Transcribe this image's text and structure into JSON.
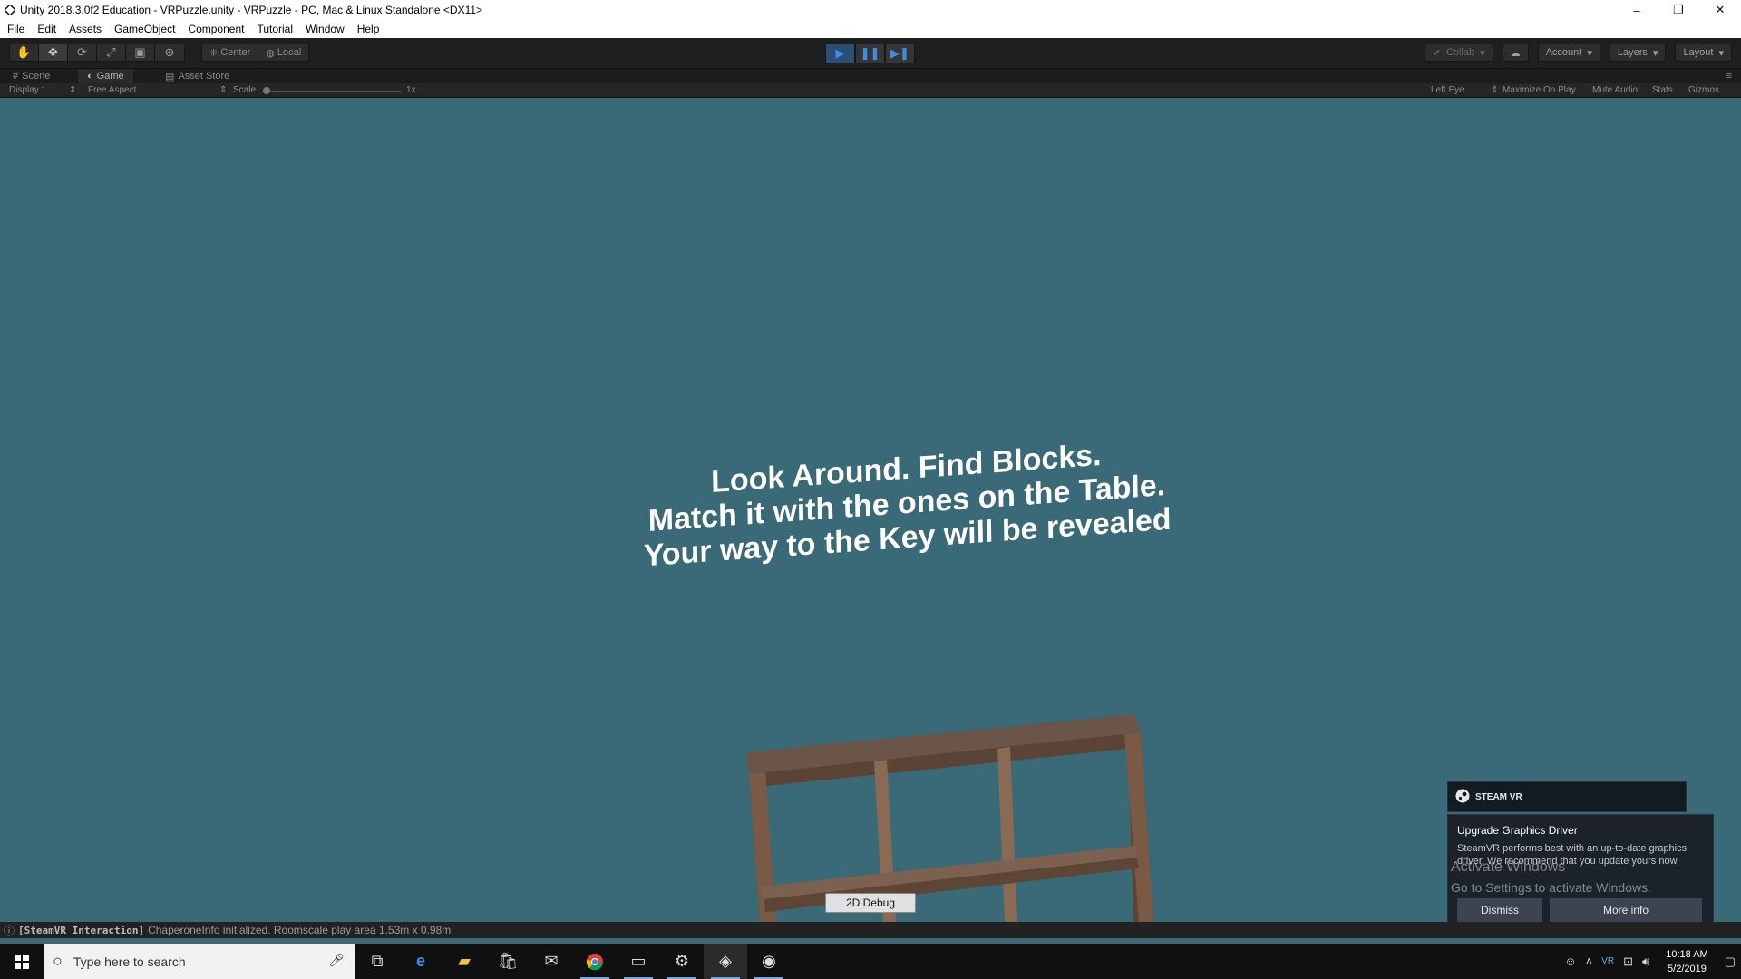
{
  "window": {
    "title": "Unity 2018.3.0f2 Education - VRPuzzle.unity - VRPuzzle - PC, Mac & Linux Standalone <DX11>",
    "minimize": "–",
    "maximize": "❐",
    "close": "✕"
  },
  "menu": [
    "File",
    "Edit",
    "Assets",
    "GameObject",
    "Component",
    "Tutorial",
    "Window",
    "Help"
  ],
  "toolbar": {
    "tools": [
      "✋",
      "✥",
      "⟳",
      "⤢",
      "▣",
      "⊕"
    ],
    "pivot_center": "Center",
    "pivot_local": "Local",
    "play": "▶",
    "pause": "❚❚",
    "step": "▶❚",
    "collab": "Collab",
    "account": "Account",
    "layers": "Layers",
    "layout": "Layout"
  },
  "tabs": [
    "Scene",
    "Game",
    "Asset Store"
  ],
  "game_bar": {
    "display": "Display 1",
    "aspect": "Free Aspect",
    "scale_label": "Scale",
    "scale_value": "1x",
    "eye": "Left Eye",
    "maximize_on_play": "Maximize On Play",
    "mute_audio": "Mute Audio",
    "stats": "Stats",
    "gizmos": "Gizmos"
  },
  "scene": {
    "line1": "Look Around. Find Blocks.",
    "line2": "Match it with the ones on the Table.",
    "line3": "Your way to the Key will be revealed",
    "debug_button": "2D Debug",
    "background_color": "#3a6a78",
    "shelf_color": "#6b5040"
  },
  "status": {
    "tag": "[SteamVR Interaction]",
    "message": "ChaperoneInfo initialized. Roomscale play area 1.53m x 0.98m"
  },
  "steamvr": {
    "brand": "STEAM VR",
    "heading": "Upgrade Graphics Driver",
    "body": "SteamVR performs best with an up-to-date graphics driver. We recommend that you update yours now.",
    "dismiss": "Dismiss",
    "more_info": "More info"
  },
  "watermark": {
    "line1": "Activate Windows",
    "line2": "Go to Settings to activate Windows."
  },
  "taskbar": {
    "search_placeholder": "Type here to search",
    "time": "10:18 AM",
    "date": "5/2/2019"
  }
}
